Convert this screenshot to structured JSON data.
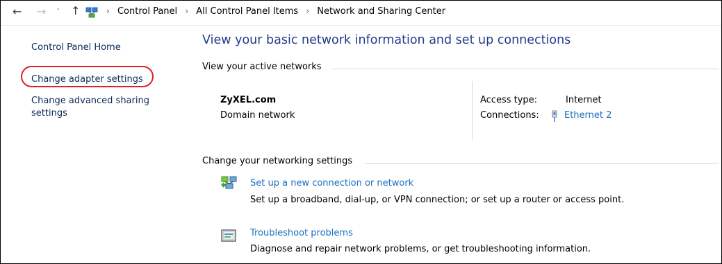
{
  "breadcrumb": {
    "items": [
      "Control Panel",
      "All Control Panel Items",
      "Network and Sharing Center"
    ],
    "separator": "›"
  },
  "nav": {
    "back_icon": "←",
    "forward_icon": "→",
    "recent_icon": "˅",
    "up_icon": "↑"
  },
  "sidebar": {
    "home": "Control Panel Home",
    "adapter": "Change adapter settings",
    "advanced": "Change advanced sharing settings"
  },
  "main": {
    "title": "View your basic network information and set up connections",
    "active_section": "View your active networks",
    "network_name": "ZyXEL.com",
    "network_type": "Domain network",
    "access_label": "Access type:",
    "access_value": "Internet",
    "connections_label": "Connections:",
    "connections_value": "Ethernet 2",
    "change_section": "Change your networking settings",
    "tasks": [
      {
        "link": "Set up a new connection or network",
        "desc": "Set up a broadband, dial-up, or VPN connection; or set up a router or access point.",
        "icon": "network-setup-icon"
      },
      {
        "link": "Troubleshoot problems",
        "desc": "Diagnose and repair network problems, or get troubleshooting information.",
        "icon": "troubleshoot-icon"
      }
    ]
  },
  "colors": {
    "link": "#1a6fbf",
    "title": "#1e3c8c",
    "highlight": "#d8232a"
  }
}
